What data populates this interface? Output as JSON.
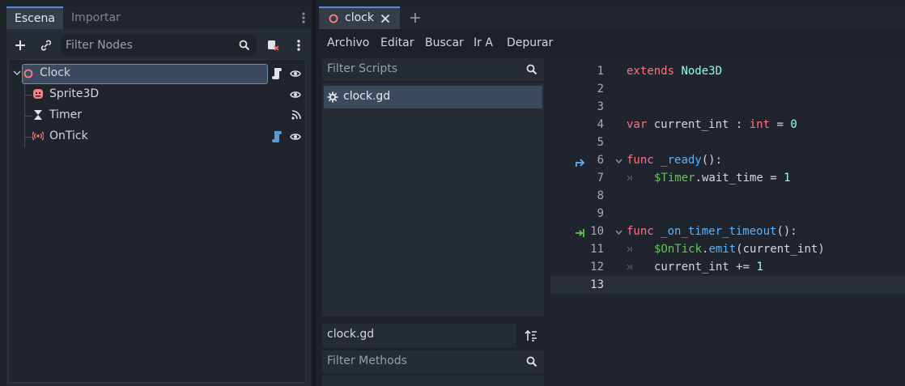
{
  "left_dock": {
    "tabs": [
      "Escena",
      "Importar"
    ],
    "filter_placeholder": "Filter Nodes",
    "tree": [
      {
        "name": "Clock",
        "icon": "node3d-icon",
        "selected": true
      },
      {
        "name": "Sprite3D",
        "icon": "sprite3d-icon"
      },
      {
        "name": "Timer",
        "icon": "timer-icon"
      },
      {
        "name": "OnTick",
        "icon": "signal-icon"
      }
    ]
  },
  "script_tab": {
    "label": "clock"
  },
  "menu": [
    "Archivo",
    "Editar",
    "Buscar",
    "Ir A",
    "Depurar"
  ],
  "scripts": {
    "filter_placeholder": "Filter Scripts",
    "items": [
      "clock.gd"
    ],
    "current_label": "clock.gd",
    "methods_placeholder": "Filter Methods"
  },
  "editor": {
    "line_numbers": [
      "1",
      "2",
      "3",
      "4",
      "5",
      "6",
      "7",
      "8",
      "9",
      "10",
      "11",
      "12",
      "13"
    ],
    "current_line": "13"
  },
  "colors": {
    "accent": "#5a8ad6",
    "keyword": "#ff7085",
    "type": "#8effda",
    "function": "#57b3ff",
    "node_ref": "#63c259"
  }
}
